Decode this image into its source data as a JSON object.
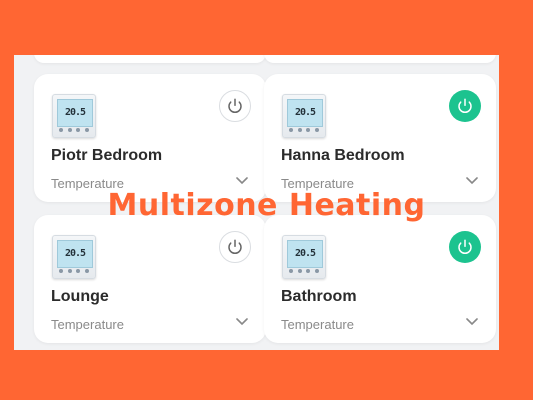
{
  "banner": {
    "title": "Multizone Heating"
  },
  "zones": [
    {
      "name": "Piotr Bedroom",
      "label": "Temperature",
      "power": "off",
      "display": "20.5"
    },
    {
      "name": "Hanna Bedroom",
      "label": "Temperature",
      "power": "on",
      "display": "20.5"
    },
    {
      "name": "Lounge",
      "label": "Temperature",
      "power": "off",
      "display": "20.5"
    },
    {
      "name": "Bathroom",
      "label": "Temperature",
      "power": "on",
      "display": "20.5"
    }
  ],
  "colors": {
    "background": "#FF6633",
    "power_on": "#1CC38F",
    "card": "#FFFFFF"
  }
}
